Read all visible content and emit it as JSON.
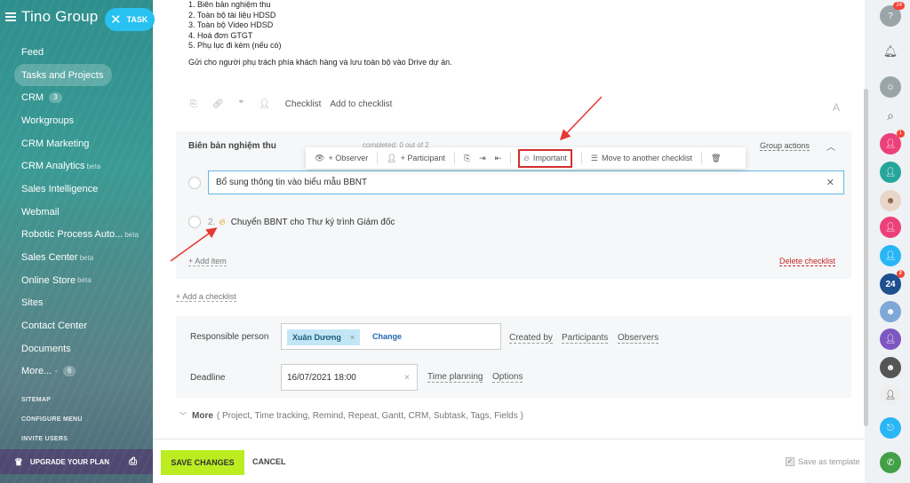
{
  "sidebar": {
    "brand": "Tino Group",
    "task_button": "TASK",
    "items": [
      {
        "label": "Feed"
      },
      {
        "label": "Tasks and Projects"
      },
      {
        "label": "CRM",
        "count": "3"
      },
      {
        "label": "Workgroups"
      },
      {
        "label": "CRM Marketing"
      },
      {
        "label": "CRM Analytics",
        "sup": "beta"
      },
      {
        "label": "Sales Intelligence"
      },
      {
        "label": "Webmail"
      },
      {
        "label": "Robotic Process Auto...",
        "sup": "beta"
      },
      {
        "label": "Sales Center",
        "sup": "beta"
      },
      {
        "label": "Online Store",
        "sup": "beta"
      },
      {
        "label": "Sites"
      },
      {
        "label": "Contact Center"
      },
      {
        "label": "Documents"
      },
      {
        "label": "More... ·",
        "count": "6"
      }
    ],
    "small_links": [
      "SITEMAP",
      "CONFIGURE MENU",
      "INVITE USERS"
    ],
    "upgrade": "UPGRADE YOUR PLAN"
  },
  "description": {
    "lines": [
      "1. Biên bản nghiệm thu",
      "2. Toàn bộ tài liệu HDSD",
      "3. Toàn bộ Video HDSD",
      "4. Hoá đơn GTGT",
      "5. Phụ lục đi kèm (nếu có)"
    ],
    "sentence": "Gửi cho người phụ trách phía khách hàng và lưu toàn bộ vào Drive dự án."
  },
  "toolbar": {
    "checklist": "Checklist",
    "add_to_checklist": "Add to checklist",
    "font": "A"
  },
  "checklist": {
    "title": "Biên bản nghiệm thu",
    "progress": "completed: 0 out of 2",
    "group_actions": "Group actions",
    "popup": {
      "observer": "+ Observer",
      "participant": "+ Participant",
      "important": "Important",
      "move": "Move to another checklist"
    },
    "items": [
      {
        "text": "Bổ sung thông tin vào biểu mẫu BBNT"
      },
      {
        "num": "2.",
        "text": "Chuyển BBNT cho Thư ký trình Giám đốc"
      }
    ],
    "add_item": "+ Add item",
    "delete": "Delete checklist"
  },
  "add_checklist": "+ Add a checklist",
  "props": {
    "responsible_label": "Responsible person",
    "responsible_value": "Xuân Dương",
    "change": "Change",
    "created_by": "Created by",
    "participants": "Participants",
    "observers": "Observers",
    "deadline_label": "Deadline",
    "deadline_value": "16/07/2021 18:00",
    "time_planning": "Time planning",
    "options": "Options"
  },
  "more": {
    "label": "More",
    "details": "( Project,  Time tracking,  Remind,  Repeat,  Gantt,  CRM,  Subtask,  Tags,  Fields )"
  },
  "footer": {
    "save": "SAVE CHANGES",
    "cancel": "CANCEL",
    "template": "Save as template"
  },
  "rightbar": {
    "help_badge": "24",
    "badge_1": "1",
    "badge_24": "2",
    "counter": "24"
  },
  "colors": {
    "accent": "#bbed21",
    "link": "#2067b0",
    "highlight": "#d32f2f",
    "task": "#28c1f0"
  }
}
